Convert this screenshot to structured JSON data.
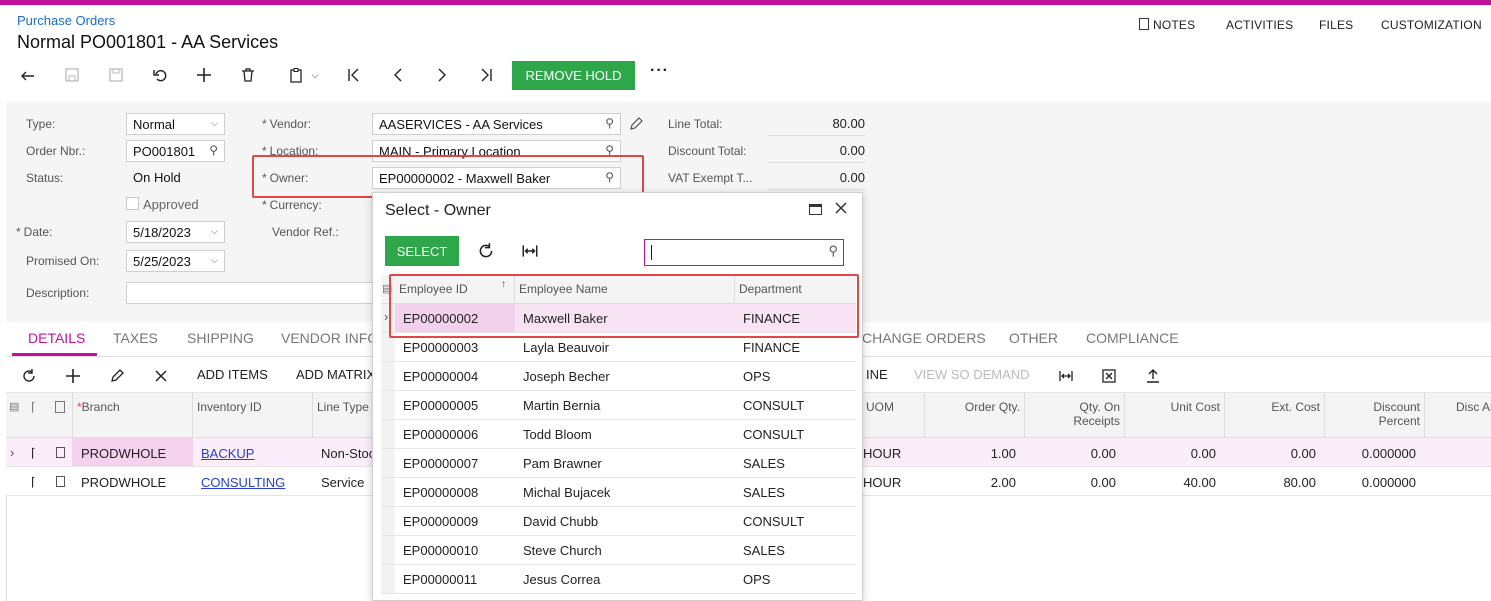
{
  "breadcrumb": "Purchase Orders",
  "page_title": "Normal PO001801 - AA Services",
  "top_nav": [
    "NOTES",
    "ACTIVITIES",
    "FILES",
    "CUSTOMIZATION"
  ],
  "toolbar": {
    "remove_hold": "REMOVE HOLD",
    "more": "···"
  },
  "form": {
    "type_label": "Type:",
    "type_value": "Normal",
    "order_nbr_label": "Order Nbr.:",
    "order_nbr_value": "PO001801",
    "status_label": "Status:",
    "status_value": "On Hold",
    "approved_label": "Approved",
    "date_label": "Date:",
    "date_value": "5/18/2023",
    "promised_label": "Promised On:",
    "promised_value": "5/25/2023",
    "description_label": "Description:",
    "vendor_label": "Vendor:",
    "vendor_value": "AASERVICES - AA Services",
    "location_label": "Location:",
    "location_value": "MAIN - Primary Location",
    "owner_label": "Owner:",
    "owner_value": "EP00000002 - Maxwell Baker",
    "currency_label": "Currency:",
    "vendor_ref_label": "Vendor Ref.:",
    "line_total_label": "Line Total:",
    "line_total_value": "80.00",
    "discount_total_label": "Discount Total:",
    "discount_total_value": "0.00",
    "vat_exempt_label": "VAT Exempt T...",
    "vat_exempt_value": "0.00"
  },
  "tabs": [
    "DETAILS",
    "TAXES",
    "SHIPPING",
    "VENDOR INFO",
    "CHANGE ORDERS",
    "OTHER",
    "COMPLIANCE"
  ],
  "grid_toolbar": {
    "add_items": "ADD ITEMS",
    "add_matrix": "ADD MATRIX",
    "line": "INE",
    "view_so_demand": "VIEW SO DEMAND"
  },
  "grid_columns": [
    "Branch",
    "Inventory ID",
    "Line Type",
    "UOM",
    "Order Qty.",
    "Qty. On Receipts",
    "Unit Cost",
    "Ext. Cost",
    "Discount Percent",
    "Disc Am"
  ],
  "grid_rows": [
    {
      "branch": "PRODWHOLE",
      "inventory_id": "BACKUP",
      "line_type": "Non-Stoc",
      "uom": "HOUR",
      "order_qty": "1.00",
      "qty_receipts": "0.00",
      "unit_cost": "0.00",
      "ext_cost": "0.00",
      "discount_percent": "0.000000"
    },
    {
      "branch": "PRODWHOLE",
      "inventory_id": "CONSULTING",
      "line_type": "Service",
      "uom": "HOUR",
      "order_qty": "2.00",
      "qty_receipts": "0.00",
      "unit_cost": "40.00",
      "ext_cost": "80.00",
      "discount_percent": "0.000000"
    }
  ],
  "modal": {
    "title": "Select - Owner",
    "select_button": "SELECT",
    "search_value": "",
    "columns": [
      "Employee ID",
      "Employee Name",
      "Department"
    ],
    "rows": [
      {
        "id": "EP00000002",
        "name": "Maxwell Baker",
        "dept": "FINANCE"
      },
      {
        "id": "EP00000003",
        "name": "Layla Beauvoir",
        "dept": "FINANCE"
      },
      {
        "id": "EP00000004",
        "name": "Joseph Becher",
        "dept": "OPS"
      },
      {
        "id": "EP00000005",
        "name": "Martin Bernia",
        "dept": "CONSULT"
      },
      {
        "id": "EP00000006",
        "name": "Todd Bloom",
        "dept": "CONSULT"
      },
      {
        "id": "EP00000007",
        "name": "Pam Brawner",
        "dept": "SALES"
      },
      {
        "id": "EP00000008",
        "name": "Michal Bujacek",
        "dept": "SALES"
      },
      {
        "id": "EP00000009",
        "name": "David Chubb",
        "dept": "CONSULT"
      },
      {
        "id": "EP00000010",
        "name": "Steve Church",
        "dept": "SALES"
      },
      {
        "id": "EP00000011",
        "name": "Jesus Correa",
        "dept": "OPS"
      }
    ]
  },
  "colors": {
    "accent": "#c0119b",
    "green": "#2ea74a",
    "highlight_red": "#e04848",
    "selected_row": "#f7e3f3"
  }
}
